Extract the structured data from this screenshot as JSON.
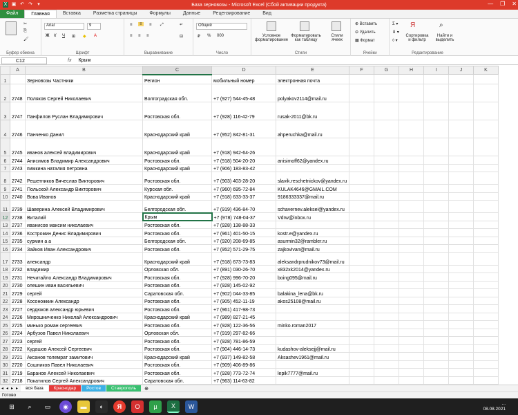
{
  "window": {
    "title": "База зерновозы  -  Microsoft Excel (Сбой активации продукта)"
  },
  "ribbon_tabs": [
    "Файл",
    "Главная",
    "Вставка",
    "Разметка страницы",
    "Формулы",
    "Данные",
    "Рецензирование",
    "Вид"
  ],
  "ribbon": {
    "clipboard_label": "Буфер обмена",
    "font_label": "Шрифт",
    "font_name": "Arial",
    "font_size": "9",
    "align_label": "Выравнивание",
    "number_label": "Число",
    "number_format": "Общий",
    "styles_label": "Стили",
    "cond_format": "Условное форматирование",
    "format_table": "Форматировать как таблицу",
    "cell_styles": "Стили ячеек",
    "cells_label": "Ячейки",
    "insert": "Вставить",
    "delete": "Удалить",
    "format": "Формат",
    "edit_label": "Редактирование",
    "sort_filter": "Сортировка и фильтр",
    "find_select": "Найти и выделить"
  },
  "formula_bar": {
    "cell": "C12",
    "fx": "fx",
    "value": "Крым"
  },
  "columns": [
    "A",
    "B",
    "C",
    "D",
    "E",
    "F",
    "G",
    "H",
    "I",
    "J",
    "K"
  ],
  "headers": {
    "b": "Зерновозы Частники",
    "c": "Регион",
    "d": "мобильный номер",
    "e": "электронная почта"
  },
  "rows": [
    {
      "n": "2",
      "a": "2748",
      "b": "Поляков Сергей Николаевич",
      "c": "Волгоградская обл.",
      "d": "+7 (927) 544-45-48",
      "e": "polyakov2114@mail.ru"
    },
    {
      "n": "3",
      "a": "2747",
      "b": "Панфилов Руслан Владимирович",
      "c": "Ростовская обл.",
      "d": "+7 (928) 116-42-79",
      "e": "rusak-2011@bk.ru"
    },
    {
      "n": "4",
      "a": "2746",
      "b": "Панченко Данил",
      "c": "Краснодарский край",
      "d": "+7 (952) 842-81-31",
      "e": "ahperuchka@mail.ru"
    },
    {
      "n": "5",
      "a": "2745",
      "b": "иванов алексей владимирович",
      "c": "Краснодарский край",
      "d": "+7 (918) 942-64-26",
      "e": ""
    },
    {
      "n": "6",
      "a": "2744",
      "b": "Анисимов Владимир Александрович",
      "c": "Ростовская обл.",
      "d": "+7 (918) 504-20-20",
      "e": "anisimoff62@yandex.ru"
    },
    {
      "n": "7",
      "a": "2743",
      "b": "пимкина наталия петровна",
      "c": "Краснодарский край",
      "d": "+7 (906) 183-83-42",
      "e": ""
    },
    {
      "n": "8",
      "a": "2742",
      "b": "Решетников Вячеслав Викторович",
      "c": "Ростовская обл.",
      "d": "+7 (903) 403-28-20",
      "e": "slavik.reschetnickov@yandex.ru"
    },
    {
      "n": "9",
      "a": "2741",
      "b": "Польской Александр Викторович",
      "c": "Курская обл.",
      "d": "+7 (960) 695-72-84",
      "e": "KULAK4646@GMAIL.COM"
    },
    {
      "n": "10",
      "a": "2740",
      "b": "Вова Иванов",
      "c": "Краснодарский край",
      "d": "+7 (918) 633-33-37",
      "e": "9186333337@mail.ru"
    },
    {
      "n": "11",
      "a": "2739",
      "b": "Шаверина Алексей Владимирович",
      "c": "Белгородская обл.",
      "d": "+7 (919) 436-84-70",
      "e": "schavernev.aleksei@yandex.ru"
    },
    {
      "n": "12",
      "a": "2738",
      "b": "Виталий",
      "c": "Крым",
      "d": "+7 (978) 748-04-37",
      "e": "Vdrw@inbox.ru"
    },
    {
      "n": "13",
      "a": "2737",
      "b": "иванисов максим николаевич",
      "c": "Ростовская обл.",
      "d": "+7 (928) 138-88-33",
      "e": ""
    },
    {
      "n": "14",
      "a": "2736",
      "b": "Костромин Денис Владимирович",
      "c": "Ростовская обл.",
      "d": "+7 (961) 401-50-15",
      "e": "kostr.e@yandex.ru"
    },
    {
      "n": "15",
      "a": "2735",
      "b": "сурмин а а",
      "c": "Белгородская обл.",
      "d": "+7 (920) 208-69-85",
      "e": "asurmin32@rambler.ru"
    },
    {
      "n": "16",
      "a": "2734",
      "b": "Зайков Иван Александрович",
      "c": "Ростовская обл.",
      "d": "+7 (952) 571-29-75",
      "e": "zajkovivan@mail.ru"
    },
    {
      "n": "17",
      "a": "2733",
      "b": "александр",
      "c": "Краснодарский край",
      "d": "+7 (918) 673-73-83",
      "e": "aleksandrprudnikov73@mail.ru"
    },
    {
      "n": "18",
      "a": "2732",
      "b": "владимир",
      "c": "Орловская обл.",
      "d": "+7 (891) 030-26-70",
      "e": "x832xk2014@yandex.ru"
    },
    {
      "n": "19",
      "a": "2731",
      "b": "Нечитайло Александр Владимирович",
      "c": "Ростовская обл.",
      "d": "+7 (928) 996-70-20",
      "e": "boing095@mail.ru"
    },
    {
      "n": "20",
      "a": "2730",
      "b": "олешин иван васильевич",
      "c": "Ростовская обл.",
      "d": "+7 (928) 145-02-92",
      "e": ""
    },
    {
      "n": "21",
      "a": "2729",
      "b": "сергей",
      "c": "Саратовская обл.",
      "d": "+7 (902) 044-33-85",
      "e": "balakina_lena@bk.ru"
    },
    {
      "n": "22",
      "a": "2728",
      "b": "Косоножкин Александр",
      "c": "Ростовская обл.",
      "d": "+7 (905) 452-11-19",
      "e": "akos25108@mail.ru"
    },
    {
      "n": "23",
      "a": "2727",
      "b": "сердюков александр юрьевич",
      "c": "Ростовская обл.",
      "d": "+7 (961) 417-98-73",
      "e": ""
    },
    {
      "n": "24",
      "a": "2726",
      "b": "Мирошниченко Николай Александрович",
      "c": "Краснодарский край",
      "d": "+7 (989) 827-21-45",
      "e": ""
    },
    {
      "n": "25",
      "a": "2725",
      "b": "минько роман сергеевич",
      "c": "Ростовская обл.",
      "d": "+7 (928) 122-36-56",
      "e": "minko.roman2017"
    },
    {
      "n": "26",
      "a": "2724",
      "b": "Арбузов Павел Николаевич",
      "c": "Орловская обл.",
      "d": "+7 (919) 297-82-66",
      "e": ""
    },
    {
      "n": "27",
      "a": "2723",
      "b": "сергей",
      "c": "Ростовская обл.",
      "d": "+7 (928) 781-86-59",
      "e": ""
    },
    {
      "n": "28",
      "a": "2722",
      "b": "Кудашов Алексей Сергеевич",
      "c": "Ростовская обл.",
      "d": "+7 (904) 446-14-73",
      "e": "kudashov-aleksejj@mail.ru"
    },
    {
      "n": "29",
      "a": "2721",
      "b": "Аксанов толемрат замитович",
      "c": "Краснодарский край",
      "d": "+7 (937) 149-82-58",
      "e": "Aksashev1961@mail.ru"
    },
    {
      "n": "30",
      "a": "2720",
      "b": "Сошников Павел Николаевич",
      "c": "Ростовская обл.",
      "d": "+7 (909) 406-89-86",
      "e": ""
    },
    {
      "n": "31",
      "a": "2719",
      "b": "Баранов Алексей Николаевич",
      "c": "Ростовская обл.",
      "d": "+7 (928) 773-72-74",
      "e": "lepik7777@mail.ru"
    },
    {
      "n": "32",
      "a": "2718",
      "b": "Покатилов Сергей Александрович",
      "c": "Саратовская обл.",
      "d": "+7 (963) 114-63-82",
      "e": ""
    }
  ],
  "sheets": [
    {
      "label": "вся база",
      "color": "#ffffff"
    },
    {
      "label": "Краснодар",
      "color": "#e63b3b"
    },
    {
      "label": "Ростов",
      "color": "#3bb0e6"
    },
    {
      "label": "Ставрополь",
      "color": "#38c070"
    }
  ],
  "status": "Готово",
  "clock": {
    "time": "...",
    "date": "08.08.2021"
  }
}
